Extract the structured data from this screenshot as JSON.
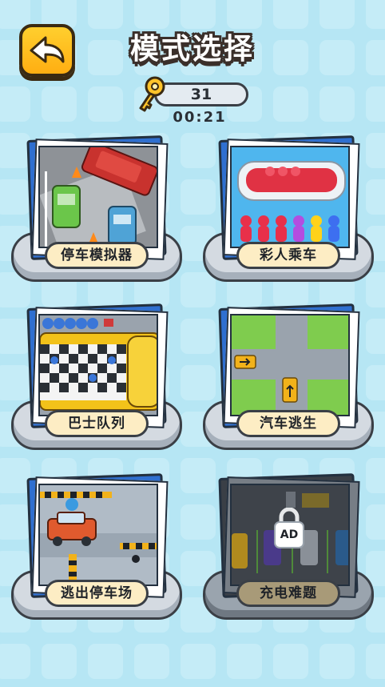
{
  "header": {
    "title": "模式选择",
    "keys_count": "31",
    "timer": "00:21"
  },
  "modes": [
    {
      "label": "停车模拟器",
      "locked": false
    },
    {
      "label": "彩人乘车",
      "locked": false
    },
    {
      "label": "巴士队列",
      "locked": false
    },
    {
      "label": "汽车逃生",
      "locked": false
    },
    {
      "label": "逃出停车场",
      "locked": false
    },
    {
      "label": "充电难题",
      "locked": true,
      "badge": "AD"
    }
  ],
  "colors": {
    "background": "#b6e6f4",
    "accent": "#ffae12",
    "frame_blue": "#2f6fd0",
    "label_bg": "#fdedc4"
  }
}
